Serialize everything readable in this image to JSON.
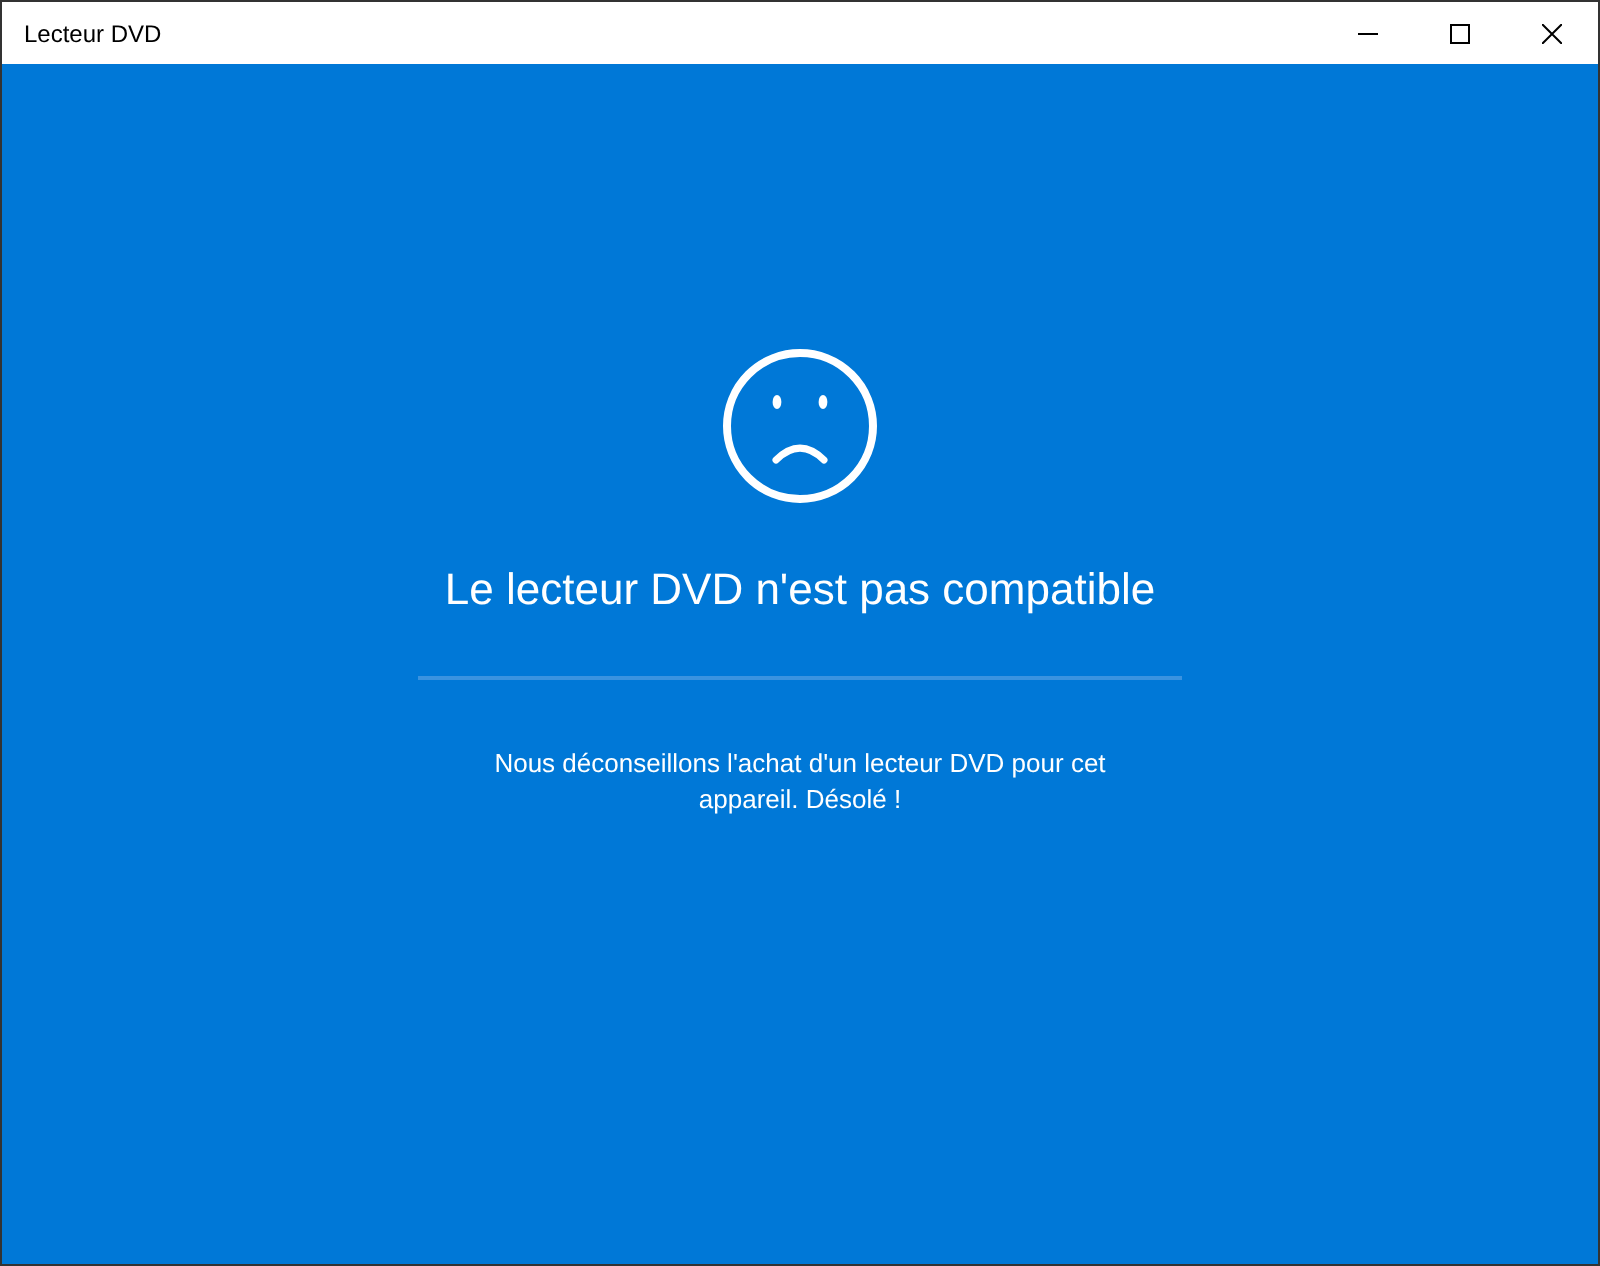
{
  "window": {
    "title": "Lecteur DVD"
  },
  "error": {
    "heading": "Le lecteur DVD n'est pas compatible",
    "message": "Nous déconseillons l'achat d'un lecteur DVD pour cet appareil. Désolé !"
  }
}
